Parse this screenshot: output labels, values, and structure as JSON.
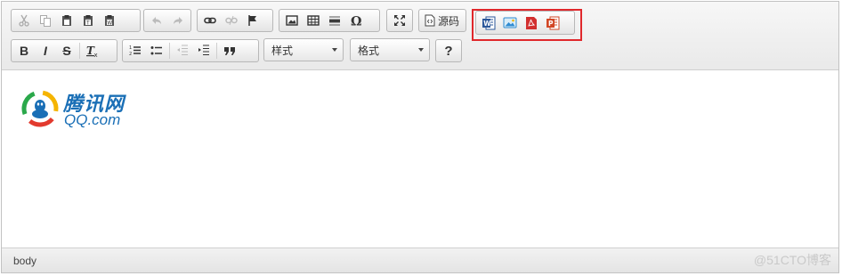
{
  "toolbar": {
    "row1": {
      "clipboard": [
        "cut-icon",
        "copy-icon",
        "paste-icon",
        "paste-text-icon",
        "paste-word-icon"
      ],
      "history": [
        "undo-icon",
        "redo-icon"
      ],
      "links": [
        "link-icon",
        "unlink-icon",
        "anchor-icon"
      ],
      "insert": [
        "image-icon",
        "table-icon",
        "horizontal-rule-icon",
        "special-char-icon"
      ],
      "maximize": "maximize-icon",
      "source_label": "源码",
      "plugins": [
        "word-icon",
        "image-upload-icon",
        "pdf-icon",
        "powerpoint-icon"
      ]
    },
    "row2": {
      "basic": [
        "B",
        "I",
        "S",
        "Tx"
      ],
      "lists": [
        "numbered-list-icon",
        "bullet-list-icon",
        "outdent-icon",
        "indent-icon",
        "blockquote-icon"
      ],
      "styles_label": "样式",
      "format_label": "格式",
      "help_label": "?"
    },
    "highlight_color": "#e0282c"
  },
  "content": {
    "logo_text": "腾讯网",
    "logo_sub": "QQ.com"
  },
  "statusbar": {
    "path": "body",
    "watermark": "@51CTO博客"
  }
}
